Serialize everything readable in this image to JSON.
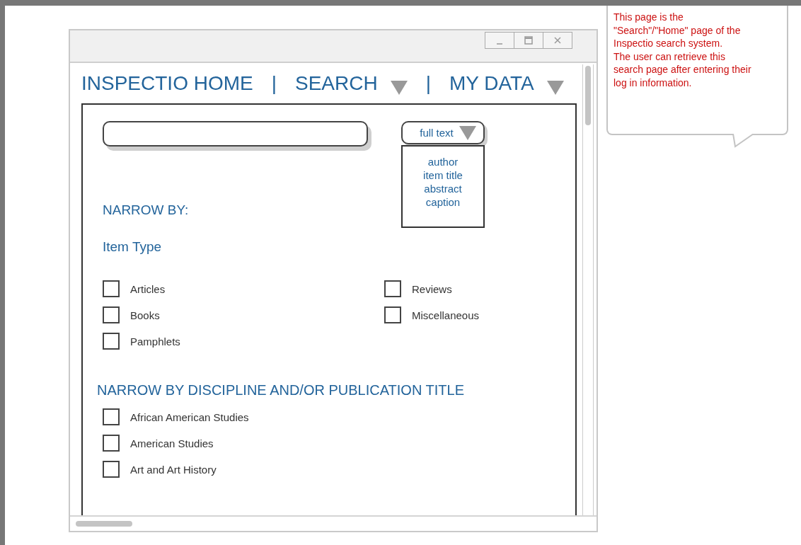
{
  "window": {
    "controls": [
      {
        "kind": "minimize"
      },
      {
        "kind": "maximize"
      },
      {
        "kind": "close"
      }
    ]
  },
  "nav": [
    {
      "kind": "link",
      "label": "INSPECTIO HOME"
    },
    {
      "kind": "separator",
      "label": "|"
    },
    {
      "kind": "menu",
      "label": "SEARCH"
    },
    {
      "kind": "separator",
      "label": "|"
    },
    {
      "kind": "menu",
      "label": "MY DATA"
    }
  ],
  "search": {
    "scope": {
      "value": "full text",
      "expanded": true,
      "options": [
        "author",
        "item title",
        "abstract",
        "caption"
      ]
    }
  },
  "narrow_heading": "NARROW BY:",
  "item_type": {
    "heading": "Item Type",
    "options": [
      {
        "label": "Articles",
        "checked": false
      },
      {
        "label": "Reviews",
        "checked": false
      },
      {
        "label": "Books",
        "checked": false
      },
      {
        "label": "Miscellaneous",
        "checked": false
      },
      {
        "label": "Pamphlets",
        "checked": false
      }
    ]
  },
  "discipline": {
    "heading": "NARROW BY DISCIPLINE AND/OR PUBLICATION TITLE",
    "options": [
      {
        "label": "African American Studies",
        "checked": false
      },
      {
        "label": "American Studies",
        "checked": false
      },
      {
        "label": "Art and Art History",
        "checked": false
      }
    ]
  },
  "annotation": {
    "lines": [
      "This page is the",
      "\"Search\"/\"Home\" page of the",
      "Inspectio search system.",
      "The user can retrieve this",
      "search page after entering their",
      "log in information."
    ]
  }
}
